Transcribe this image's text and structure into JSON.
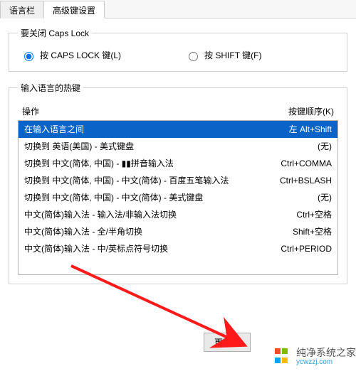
{
  "tabs": {
    "lang_bar": "语言栏",
    "advanced": "高级键设置"
  },
  "capslock_group": {
    "legend": "要关闭 Caps Lock",
    "opt_caps": "按 CAPS LOCK 键(L)",
    "opt_shift": "按 SHIFT 键(F)"
  },
  "hotkeys_group": {
    "legend": "输入语言的热键",
    "header_action": "操作",
    "header_key": "按键顺序(K)",
    "rows": [
      {
        "action": "在输入语言之间",
        "key": "左 Alt+Shift",
        "selected": true
      },
      {
        "action": "切换到 英语(美国) - 美式键盘",
        "key": "(无)",
        "selected": false
      },
      {
        "action": "切换到 中文(简体, 中国) - ▮▮拼音输入法",
        "key": "Ctrl+COMMA",
        "selected": false
      },
      {
        "action": "切换到 中文(简体, 中国) - 中文(简体) - 百度五笔输入法",
        "key": "Ctrl+BSLASH",
        "selected": false
      },
      {
        "action": "切换到 中文(简体, 中国) - 中文(简体) - 美式键盘",
        "key": "(无)",
        "selected": false
      },
      {
        "action": "中文(简体)输入法 - 输入法/非输入法切换",
        "key": "Ctrl+空格",
        "selected": false
      },
      {
        "action": "中文(简体)输入法 - 全/半角切换",
        "key": "Shift+空格",
        "selected": false
      },
      {
        "action": "中文(简体)输入法 - 中/英标点符号切换",
        "key": "Ctrl+PERIOD",
        "selected": false
      }
    ],
    "change_button": "更改按"
  },
  "watermark": {
    "line1": "纯净系统之家",
    "line2": "ycwzzj.com"
  }
}
